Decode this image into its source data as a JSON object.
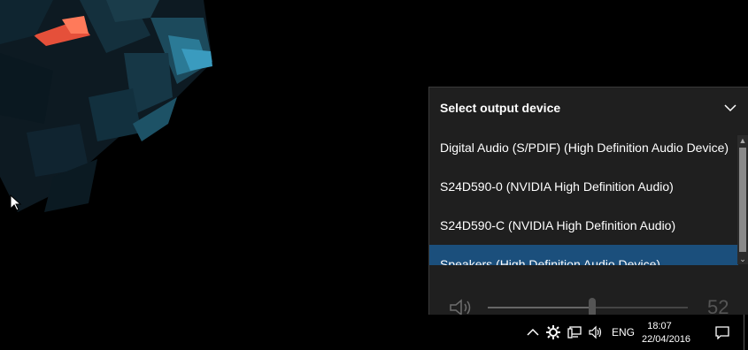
{
  "flyout": {
    "title": "Select output device",
    "devices": [
      {
        "label": "Digital Audio (S/PDIF) (High Definition Audio Device)",
        "selected": false
      },
      {
        "label": "S24D590-0 (NVIDIA High Definition Audio)",
        "selected": false
      },
      {
        "label": "S24D590-C (NVIDIA High Definition Audio)",
        "selected": false
      },
      {
        "label": "Speakers (High Definition Audio Device)",
        "selected": true
      }
    ],
    "volume": {
      "value": "52",
      "level": 0.52
    },
    "selected_color": "#1b4f7c"
  },
  "taskbar": {
    "language": "ENG",
    "time": "18:07",
    "date": "22/04/2016",
    "icons": [
      "chevron-up-icon",
      "settings-gear-icon",
      "network-icon",
      "speaker-icon",
      "action-center-icon"
    ]
  }
}
